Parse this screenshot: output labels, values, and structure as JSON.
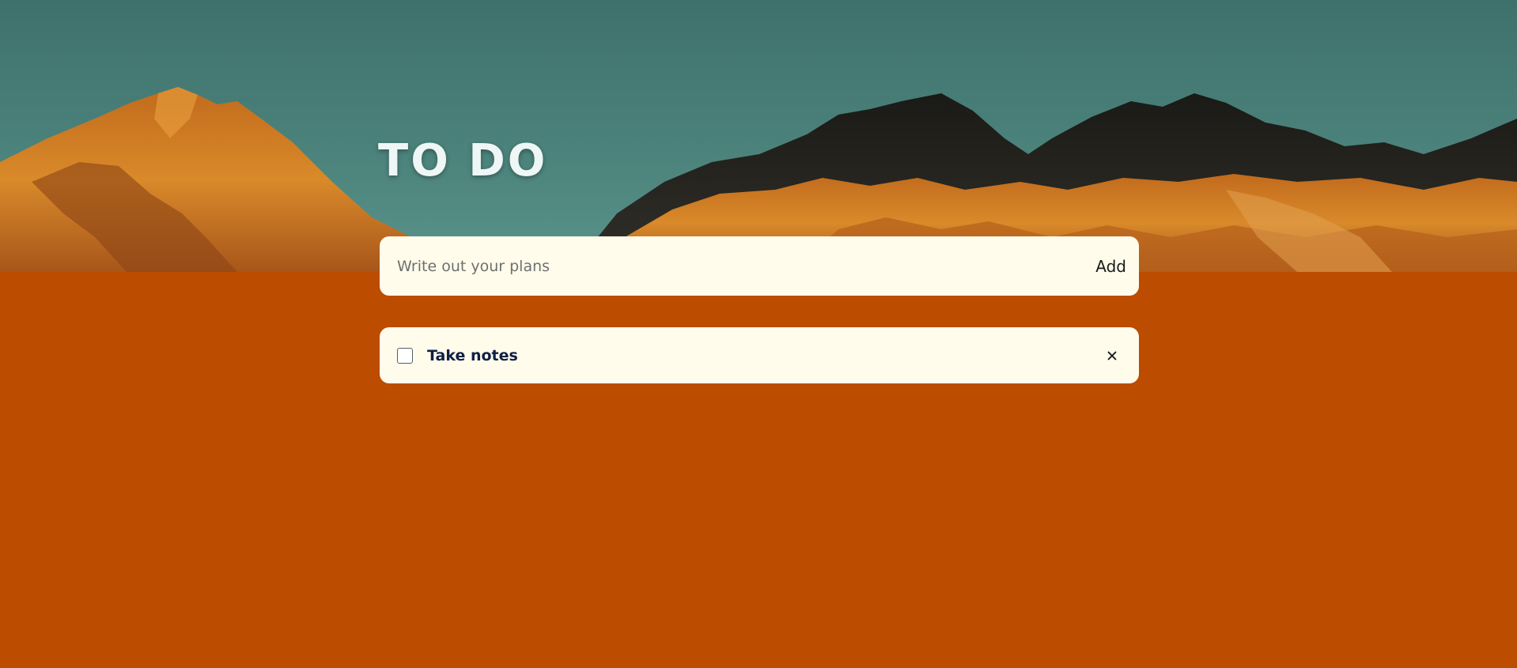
{
  "header": {
    "title": "TO DO"
  },
  "new_task": {
    "placeholder": "Write out your plans",
    "value": "",
    "add_label": "Add"
  },
  "tasks": [
    {
      "text": "Take notes",
      "done": false,
      "delete_icon": "close-icon"
    }
  ],
  "colors": {
    "sky": "#3f716c",
    "background": "#bc4c00",
    "card": "#fffceb",
    "task_text": "#0f1f45",
    "title": "#eef6f6"
  }
}
